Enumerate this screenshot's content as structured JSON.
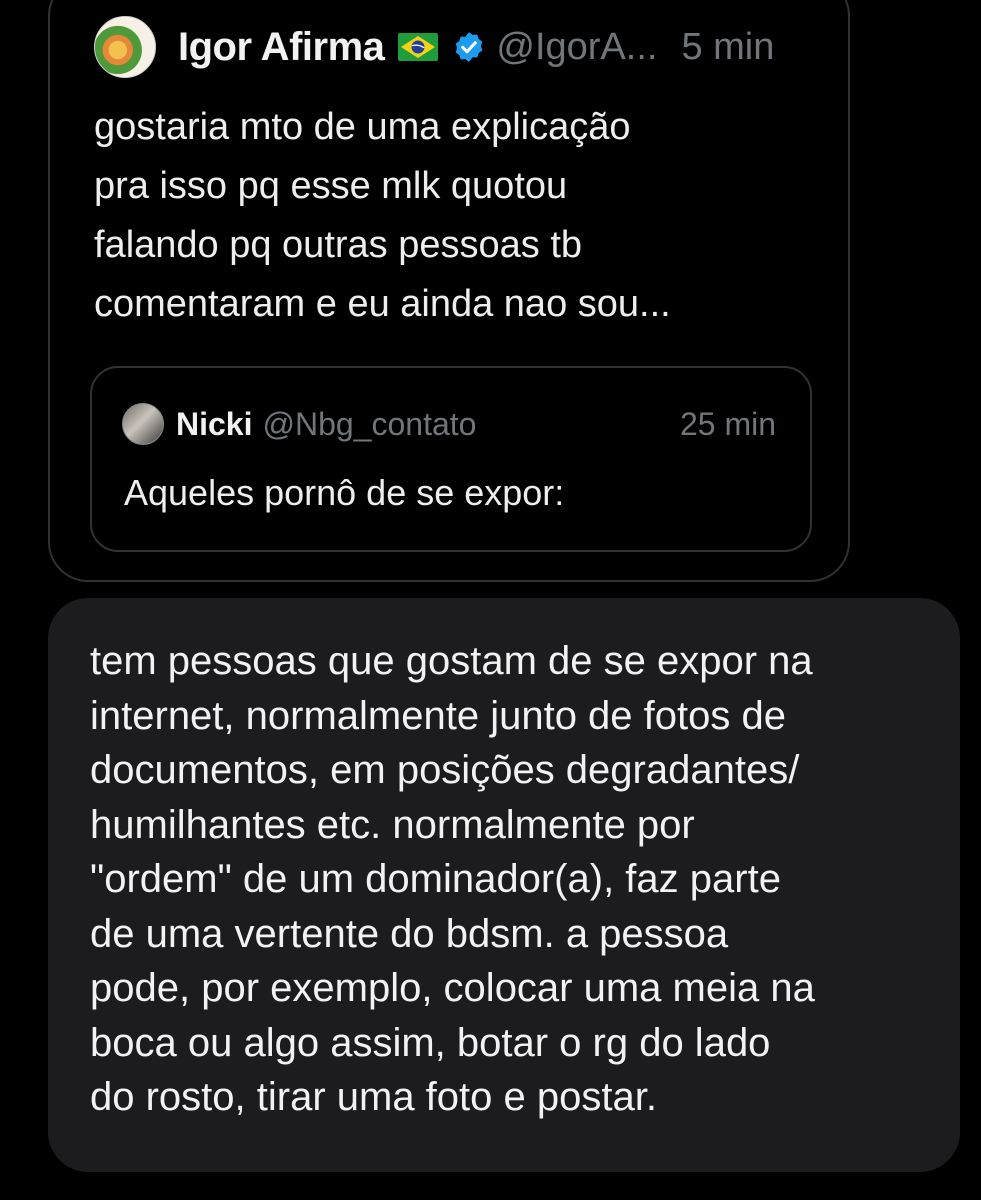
{
  "quoted_tweet": {
    "display_name": "Igor Afirma",
    "flag_icon": "brazil-flag-icon",
    "verified_icon": "verified-badge-icon",
    "verified_color": "#1d9bf0",
    "handle": "@IgorA...",
    "timestamp": "5 min",
    "text": "gostaria mto de uma explicação\npra isso pq esse mlk quotou\nfalando pq outras pessoas tb\ncomentaram e eu ainda nao sou...",
    "nested_quote": {
      "display_name": "Nicki",
      "handle": "@Nbg_contato",
      "timestamp": "25 min",
      "text": "Aqueles pornô de se expor:"
    }
  },
  "reply": {
    "text": "tem pessoas que gostam de se expor na\ninternet, normalmente junto de fotos de\ndocumentos, em posições degradantes/\nhumilhantes etc. normalmente por\n\"ordem\" de um dominador(a), faz parte\nde uma vertente do bdsm. a pessoa\npode, por exemplo, colocar uma meia na\nboca ou algo assim, botar o rg do lado\ndo rosto, tirar uma foto e postar."
  },
  "colors": {
    "background": "#000000",
    "bubble": "#1c1c1e",
    "border": "#2f3336",
    "muted_text": "#71767b"
  }
}
